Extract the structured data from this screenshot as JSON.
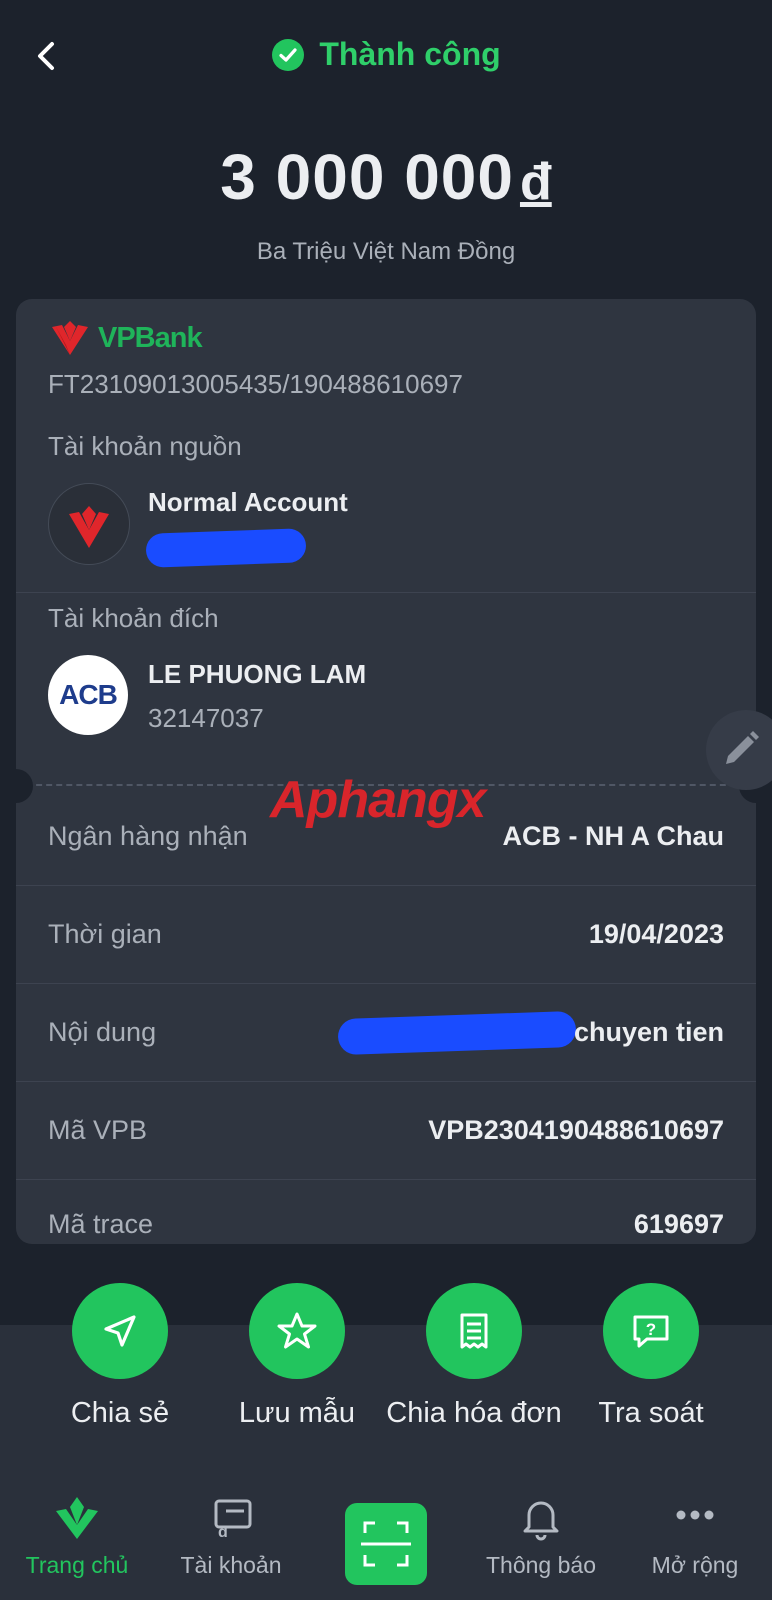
{
  "header": {
    "status": "Thành công",
    "amount": "3 000 000",
    "currency": "đ",
    "amount_words": "Ba Triệu Việt Nam Đồng"
  },
  "receipt": {
    "bank_logo_text": "VPBank",
    "transaction_ref": "FT23109013005435/190488610697",
    "source_label": "Tài khoản nguồn",
    "source_name": "Normal Account",
    "dest_label": "Tài khoản đích",
    "dest_bank_logo": "ACB",
    "dest_name": "LE PHUONG LAM",
    "dest_number": "32147037",
    "rows": [
      {
        "label": "Ngân hàng nhận",
        "value": "ACB - NH A Chau"
      },
      {
        "label": "Thời gian",
        "value": "19/04/2023"
      },
      {
        "label": "Nội dung",
        "value": "chuyen tien"
      },
      {
        "label": "Mã VPB",
        "value": "VPB2304190488610697"
      },
      {
        "label": "Mã trace",
        "value": "619697"
      }
    ]
  },
  "watermark": {
    "text": "Aphangx"
  },
  "actions": [
    {
      "label": "Chia sẻ",
      "icon": "send-icon"
    },
    {
      "label": "Lưu mẫu",
      "icon": "star-icon"
    },
    {
      "label": "Chia hóa đơn",
      "icon": "receipt-icon"
    },
    {
      "label": "Tra soát",
      "icon": "help-chat-icon"
    }
  ],
  "tabs": [
    {
      "label": "Trang chủ",
      "icon": "home-leaf-icon",
      "active": true
    },
    {
      "label": "Tài khoản",
      "icon": "wallet-icon"
    },
    {
      "label": "Thông báo",
      "icon": "bell-icon"
    },
    {
      "label": "Mở rộng",
      "icon": "more-icon"
    }
  ],
  "colors": {
    "accent": "#22c55e",
    "background": "#1c222c",
    "card": "#2f3540",
    "vpbank_red": "#e0262b",
    "vpbank_green": "#1fb45a",
    "acb_blue": "#1e3c8c"
  }
}
